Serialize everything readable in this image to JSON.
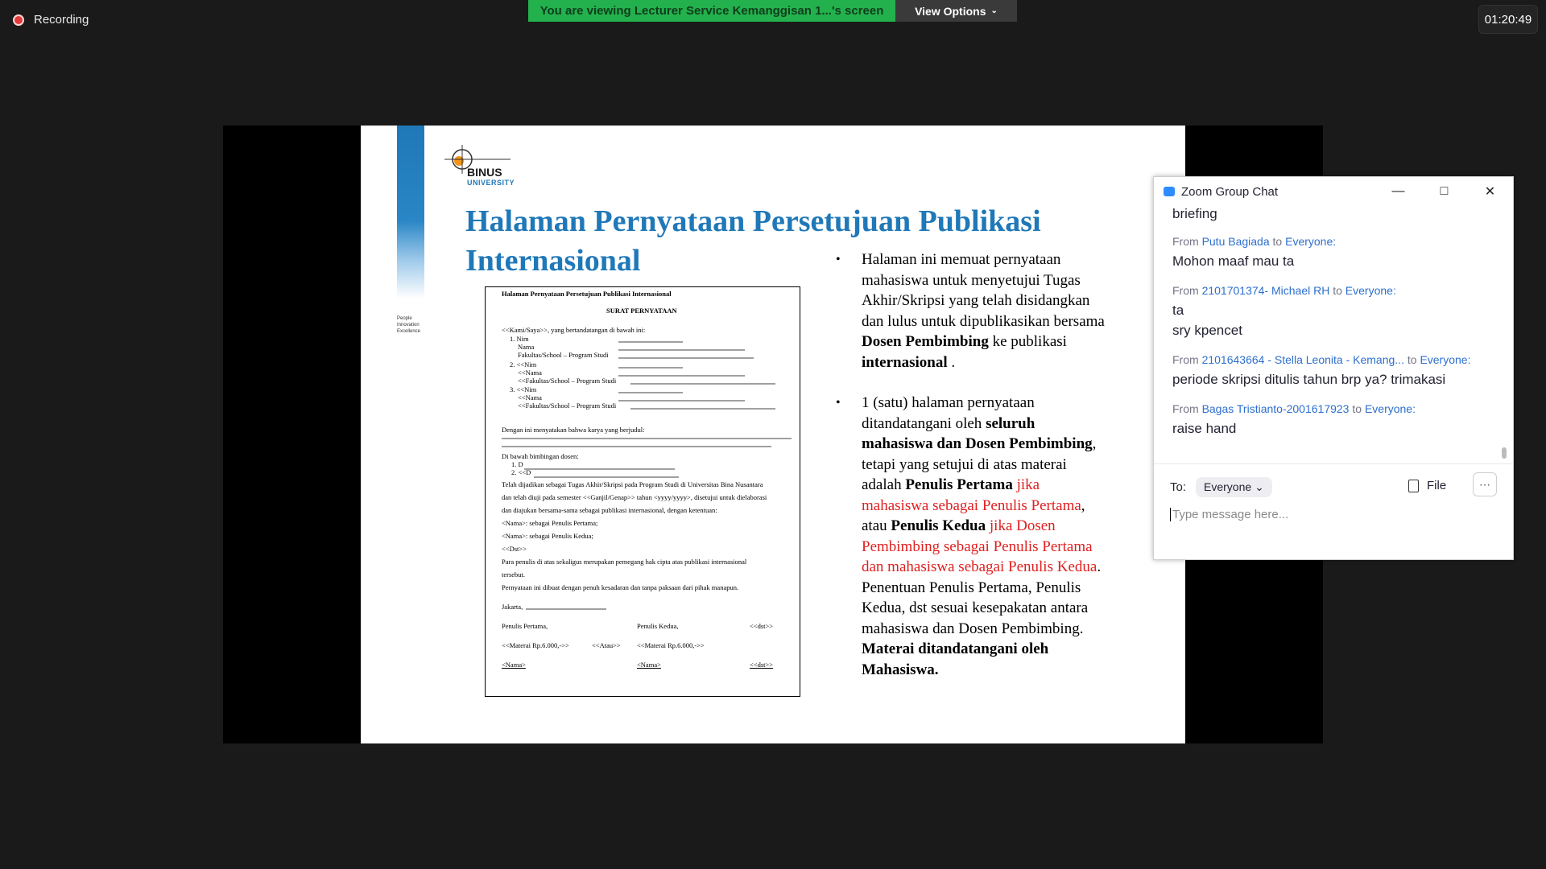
{
  "meeting": {
    "recording_label": "Recording",
    "banner_text": "You are viewing Lecturer Service Kemanggisan 1...'s screen",
    "view_options": "View Options",
    "timer": "01:20:49"
  },
  "slide": {
    "logo_text": "BINUS",
    "logo_sub": "UNIVERSITY",
    "tagline": [
      "People",
      "Innovation",
      "Excellence"
    ],
    "title_line1": "Halaman Pernyataan Persetujuan Publikasi",
    "title_line2": "Internasional",
    "doc": {
      "header": "Halaman Pernyataan Persetujuan Publikasi Internasional",
      "heading": "SURAT PERNYATAAN",
      "intro": "<<Kami/Saya>>, yang bertandatangan di bawah ini:",
      "l1": "1. Nim",
      "l2": "Nama",
      "l3": "Fakultas/School – Program Studi",
      "l4": "2. <<Nim",
      "l5": "<<Nama",
      "l6": "<<Fakultas/School – Program Studi",
      "l7": "3. <<Nim",
      "l8": "<<Nama",
      "l9": "<<Fakultas/School – Program Studi",
      "statement": "Dengan ini menyatakan bahwa karya yang berjudul:",
      "supervisor": "Di bawah bimbingan dosen:",
      "s1": "1. D",
      "s2": "2. <<D",
      "p1": "Telah dijadikan sebagai Tugas Akhir/Skripsi pada Program Studi di Universitas Bina Nusantara",
      "p2": "dan telah diuji pada semester <<Ganjil/Genap>> tahun <yyyy/yyyy>, disetujui untuk dielaborasi",
      "p3": "dan diajukan bersama-sama sebagai publikasi internasional, dengan ketentuan:",
      "p4": "<Nama>: sebagai Penulis Pertama;",
      "p5": "<Nama>: sebagai Penulis Kedua;",
      "p6": "<<Dst>>",
      "p7": "Para penulis di atas sekaligus merupakan pemegang hak cipta atas publikasi internasional",
      "p8": "tersebut.",
      "p9": "Pernyataan ini dibuat dengan penuh kesadaran dan tanpa paksaan dari pihak manapun.",
      "place": "Jakarta,",
      "sig1": "Penulis Pertama,",
      "sig2": "Penulis Kedua,",
      "sig3": "<<dst>>",
      "m1": "<<Materai Rp.6.000,->>",
      "m2": "<<Atau>>",
      "m3": "<<Materai Rp.6.000,->>",
      "n1": "<Nama>",
      "n2": "<Nama>",
      "n3": "<<dst>>"
    },
    "bullet1": {
      "t1": "Halaman ini memuat pernyataan mahasiswa untuk menyetujui Tugas Akhir/Skripsi yang telah disidangkan dan lulus untuk dipublikasikan bersama ",
      "b1": "Dosen Pembimbing",
      "t2": " ke publikasi ",
      "b2": "internasional",
      "t3": " ."
    },
    "bullet2": {
      "t1": "1 (satu) halaman pernyataan ditandatangani oleh ",
      "b1": "seluruh mahasiswa dan Dosen Pembimbing",
      "t2": ", tetapi yang setujui di atas materai adalah ",
      "b2": "Penulis Pertama",
      "r1": " jika mahasiswa sebagai Penulis Pertama",
      "t3": ", atau ",
      "b3": "Penulis Kedua",
      "r2": " jika Dosen Pembimbing sebagai Penulis Pertama dan mahasiswa sebagai Penulis Kedua",
      "t4": ". Penentuan Penulis Pertama, Penulis Kedua, dst sesuai kesepakatan antara mahasiswa dan Dosen Pembimbing. ",
      "b4": "Materai ditandatangani oleh Mahasiswa."
    },
    "colors": {
      "title_blue": "#1f78b8",
      "red": "#e02020"
    }
  },
  "chat": {
    "title": "Zoom Group Chat",
    "partial_message": "briefing",
    "messages": [
      {
        "from": "From",
        "sender": "Putu Bagiada",
        "to": "to",
        "recipient": "Everyone:",
        "lines": [
          "Mohon maaf mau ta"
        ]
      },
      {
        "from": "From",
        "sender": "2101701374- Michael RH",
        "to": "to",
        "recipient": "Everyone:",
        "lines": [
          "ta",
          "sry kpencet"
        ]
      },
      {
        "from": "From",
        "sender": "2101643664 - Stella Leonita - Kemang...",
        "to": "to",
        "recipient": "Everyone:",
        "lines": [
          "periode skripsi ditulis tahun brp ya? trimakasi"
        ]
      },
      {
        "from": "From",
        "sender": "Bagas Tristianto-2001617923",
        "to": "to",
        "recipient": "Everyone:",
        "lines": [
          "raise hand"
        ]
      }
    ],
    "to_label": "To:",
    "to_value": "Everyone",
    "file_label": "File",
    "input_placeholder": "Type message here..."
  }
}
